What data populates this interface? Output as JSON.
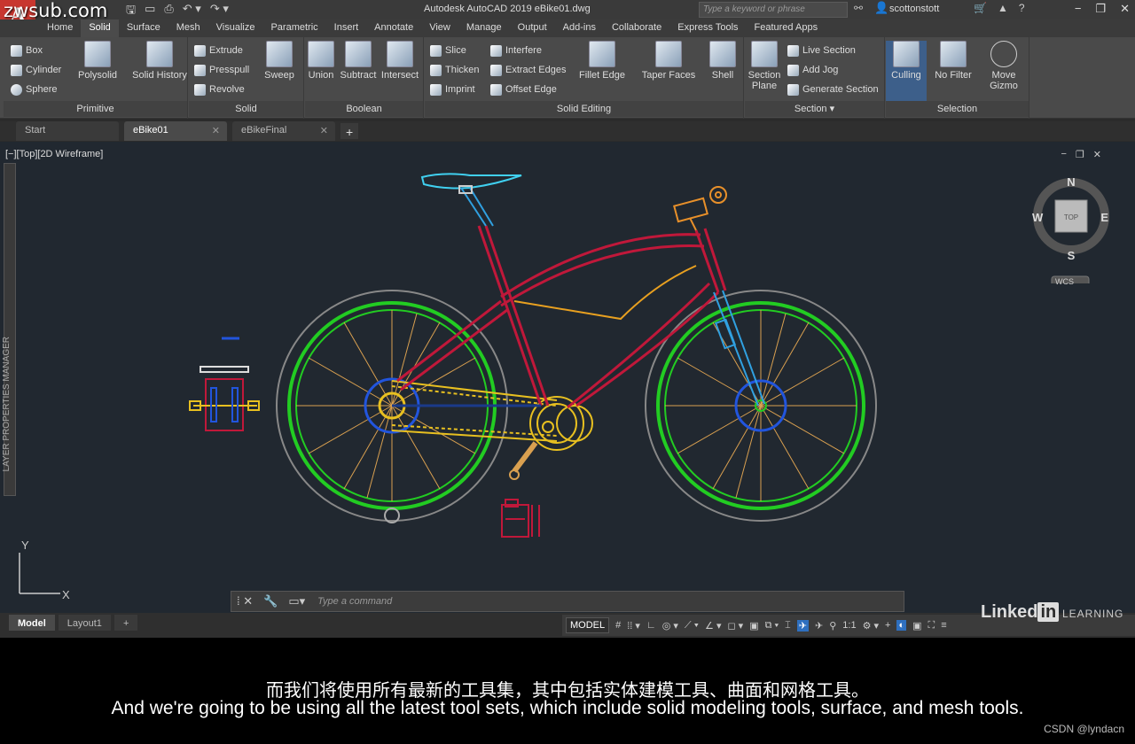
{
  "watermark": "zwsub.com",
  "app": {
    "logo": "A",
    "title": "Autodesk AutoCAD 2019    eBike01.dwg",
    "search_placeholder": "Type a keyword or phrase",
    "user": "scottonstott"
  },
  "ribbon_tabs": [
    "Home",
    "Solid",
    "Surface",
    "Mesh",
    "Visualize",
    "Parametric",
    "Insert",
    "Annotate",
    "View",
    "Manage",
    "Output",
    "Add-ins",
    "Collaborate",
    "Express Tools",
    "Featured Apps"
  ],
  "active_ribbon_tab": "Solid",
  "panels": {
    "primitive": {
      "title": "Primitive",
      "small": [
        "Box",
        "Cylinder",
        "Sphere"
      ],
      "big": [
        "Polysolid",
        "Solid History"
      ]
    },
    "solid": {
      "title": "Solid",
      "small": [
        "Extrude",
        "Presspull",
        "Revolve"
      ],
      "big": [
        "Sweep"
      ]
    },
    "boolean": {
      "title": "Boolean",
      "big": [
        "Union",
        "Subtract",
        "Intersect"
      ]
    },
    "solid_editing": {
      "title": "Solid Editing",
      "small": [
        "Slice",
        "Thicken",
        "Imprint",
        "Interfere",
        "Extract Edges",
        "Offset Edge"
      ],
      "big": [
        "Fillet Edge",
        "Taper Faces",
        "Shell"
      ]
    },
    "section": {
      "title": "Section",
      "big": [
        "Section Plane"
      ],
      "small": [
        "Live Section",
        "Add Jog",
        "Generate Section"
      ]
    },
    "selection": {
      "title": "Selection",
      "big": [
        "Culling",
        "No Filter",
        "Move Gizmo"
      ]
    }
  },
  "doc_tabs": [
    "Start",
    "eBike01",
    "eBikeFinal"
  ],
  "active_doc_tab": "eBike01",
  "viewport": {
    "label": "[−][Top][2D Wireframe]",
    "side_panel": "LAYER PROPERTIES MANAGER",
    "viewcube": {
      "n": "N",
      "s": "S",
      "e": "E",
      "w": "W",
      "face": "TOP",
      "wcs": "WCS"
    },
    "ucs": {
      "x": "X",
      "y": "Y"
    }
  },
  "command": {
    "placeholder": "Type  a  command"
  },
  "layout_tabs": [
    "Model",
    "Layout1"
  ],
  "status": {
    "model": "MODEL",
    "scale": "1:1"
  },
  "branding": {
    "linkedin": "Linked",
    "in": "in",
    "learning": "LEARNING"
  },
  "subtitles": {
    "cn": "而我们将使用所有最新的工具集，其中包括实体建模工具、曲面和网格工具。",
    "en": "And we're going to be using all the latest tool sets, which include solid modeling tools, surface, and mesh tools."
  },
  "credit": "CSDN @lyndacn",
  "colors": {
    "background": "#212830",
    "wheel": "#22cc22",
    "frame": "#c0183a",
    "spokes": "#d9a050",
    "chain": "#e8c020",
    "hub": "#2255dd",
    "fork": "#30a0e0",
    "seat": "#40d0f0",
    "accent": "#2e6fbf"
  }
}
